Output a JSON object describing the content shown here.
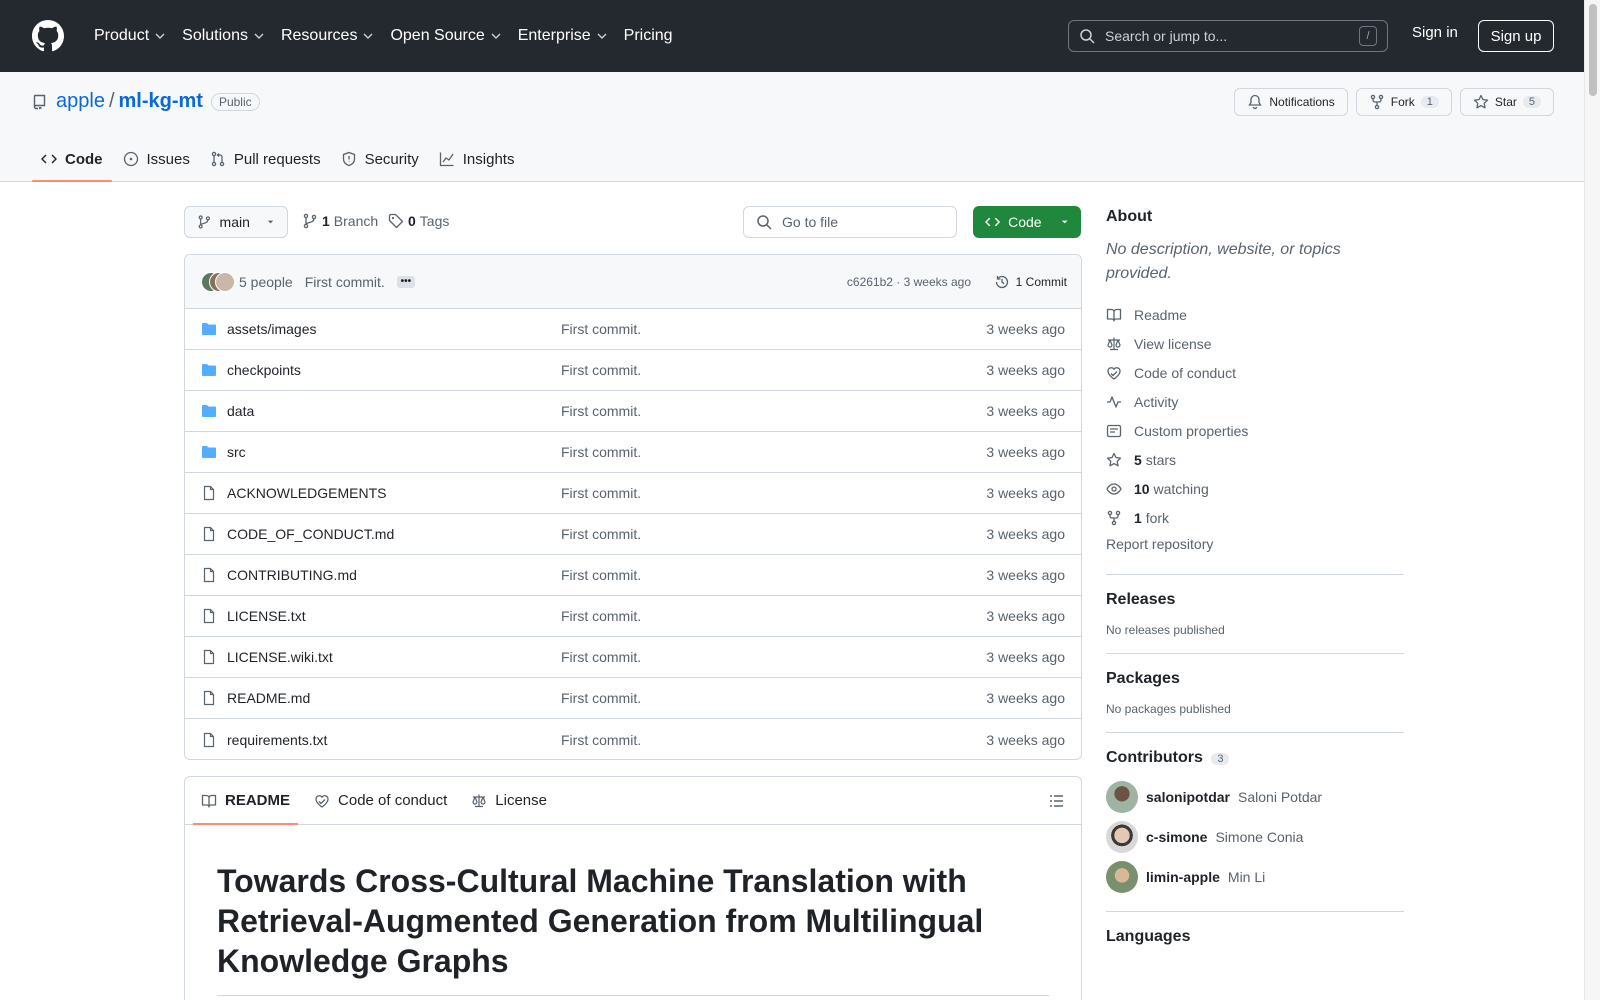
{
  "header": {
    "nav": [
      "Product",
      "Solutions",
      "Resources",
      "Open Source",
      "Enterprise",
      "Pricing"
    ],
    "search_placeholder": "Search or jump to...",
    "search_shortcut": "/",
    "sign_in": "Sign in",
    "sign_up": "Sign up"
  },
  "repo": {
    "owner": "apple",
    "separator": "/",
    "name": "ml-kg-mt",
    "visibility": "Public",
    "notifications_label": "Notifications",
    "fork_label": "Fork",
    "fork_count": "1",
    "star_label": "Star",
    "star_count": "5",
    "tabs": [
      "Code",
      "Issues",
      "Pull requests",
      "Security",
      "Insights"
    ]
  },
  "branchbar": {
    "branch": "main",
    "branch_count": "1",
    "branch_label": "Branch",
    "tag_count": "0",
    "tag_label": "Tags",
    "go_to_file": "Go to file",
    "code_button": "Code"
  },
  "commit": {
    "people": "5 people",
    "message": "First commit.",
    "dots": "•••",
    "hash_time": "c6261b2 · 3 weeks ago",
    "commit_count": "1 Commit"
  },
  "files": [
    {
      "name": "assets/images",
      "type": "dir",
      "msg": "First commit.",
      "age": "3 weeks ago"
    },
    {
      "name": "checkpoints",
      "type": "dir",
      "msg": "First commit.",
      "age": "3 weeks ago"
    },
    {
      "name": "data",
      "type": "dir",
      "msg": "First commit.",
      "age": "3 weeks ago"
    },
    {
      "name": "src",
      "type": "dir",
      "msg": "First commit.",
      "age": "3 weeks ago"
    },
    {
      "name": "ACKNOWLEDGEMENTS",
      "type": "file",
      "msg": "First commit.",
      "age": "3 weeks ago"
    },
    {
      "name": "CODE_OF_CONDUCT.md",
      "type": "file",
      "msg": "First commit.",
      "age": "3 weeks ago"
    },
    {
      "name": "CONTRIBUTING.md",
      "type": "file",
      "msg": "First commit.",
      "age": "3 weeks ago"
    },
    {
      "name": "LICENSE.txt",
      "type": "file",
      "msg": "First commit.",
      "age": "3 weeks ago"
    },
    {
      "name": "LICENSE.wiki.txt",
      "type": "file",
      "msg": "First commit.",
      "age": "3 weeks ago"
    },
    {
      "name": "README.md",
      "type": "file",
      "msg": "First commit.",
      "age": "3 weeks ago"
    },
    {
      "name": "requirements.txt",
      "type": "file",
      "msg": "First commit.",
      "age": "3 weeks ago"
    }
  ],
  "readme": {
    "tabs": [
      "README",
      "Code of conduct",
      "License"
    ],
    "title": "Towards Cross-Cultural Machine Translation with Retrieval-Augmented Generation from Multilingual Knowledge Graphs"
  },
  "sidebar": {
    "about_title": "About",
    "about_desc": "No description, website, or topics provided.",
    "links": [
      {
        "icon": "book-icon",
        "text": "Readme"
      },
      {
        "icon": "law-icon",
        "text": "View license"
      },
      {
        "icon": "heart-icon",
        "text": "Code of conduct"
      },
      {
        "icon": "pulse-icon",
        "text": "Activity"
      },
      {
        "icon": "note-icon",
        "text": "Custom properties"
      }
    ],
    "stats": [
      {
        "icon": "star-icon",
        "num": "5",
        "text": "stars"
      },
      {
        "icon": "eye-icon",
        "num": "10",
        "text": "watching"
      },
      {
        "icon": "fork-icon",
        "num": "1",
        "text": "fork"
      }
    ],
    "report": "Report repository",
    "releases_title": "Releases",
    "releases_text": "No releases published",
    "packages_title": "Packages",
    "packages_text": "No packages published",
    "contributors_title": "Contributors",
    "contributors_count": "3",
    "contributors": [
      {
        "login": "salonipotdar",
        "name": "Saloni Potdar"
      },
      {
        "login": "c-simone",
        "name": "Simone Conia"
      },
      {
        "login": "limin-apple",
        "name": "Min Li"
      }
    ],
    "languages_title": "Languages"
  },
  "colors": {
    "header_bg": "#24292f",
    "link": "#0969da",
    "green": "#1f883d",
    "folder": "#54aeff",
    "tab_underline": "#fd8c73"
  }
}
